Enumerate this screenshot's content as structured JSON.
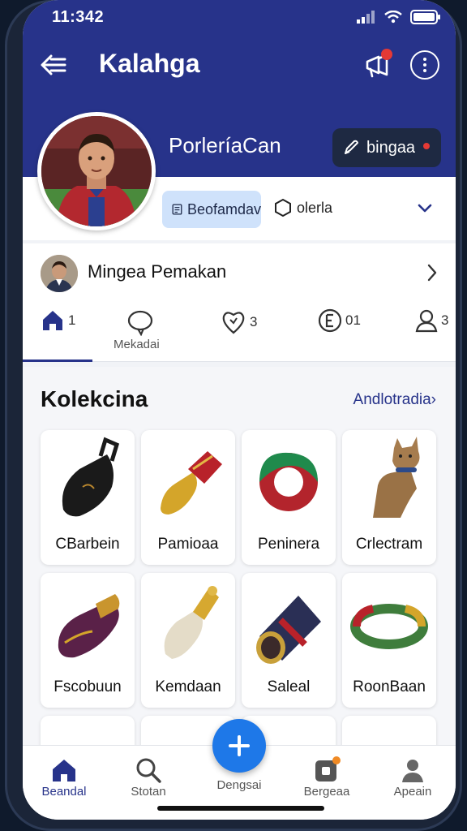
{
  "status_bar": {
    "time": "11:342"
  },
  "app_bar": {
    "title": "Kalahga"
  },
  "profile": {
    "name": "PorleríaCan",
    "action_label": "bingaa",
    "chip_active_label": "Beofamdav",
    "chip_label": "olerla"
  },
  "user_row": {
    "name": "Mingea Pemakan"
  },
  "stats": [
    {
      "value": "1"
    },
    {
      "label": "Mekadai"
    },
    {
      "value": "3"
    },
    {
      "value": "01"
    },
    {
      "value": "3"
    }
  ],
  "collection": {
    "title": "Kolekcina",
    "link": "Andlotradia",
    "items": [
      {
        "label": "CBarbein",
        "icon": "black-bag-icon"
      },
      {
        "label": "Pamioaa",
        "icon": "gold-shoe-icon"
      },
      {
        "label": "Peninera",
        "icon": "green-ring-icon"
      },
      {
        "label": "Crlectram",
        "icon": "cat-figure-icon"
      },
      {
        "label": "Fscobuun",
        "icon": "purple-shoe-icon"
      },
      {
        "label": "Kemdaan",
        "icon": "pearl-ornament-icon"
      },
      {
        "label": "Saleal",
        "icon": "scroll-icon"
      },
      {
        "label": "RoonBaan",
        "icon": "bracelet-icon"
      }
    ]
  },
  "bottom_nav": [
    {
      "label": "Beandal",
      "icon": "home-icon",
      "active": true
    },
    {
      "label": "Stotan",
      "icon": "search-icon"
    },
    {
      "label": "Dengsai",
      "icon": "plus-icon"
    },
    {
      "label": "Bergeaa",
      "icon": "badge-icon"
    },
    {
      "label": "Apeain",
      "icon": "person-icon"
    }
  ],
  "colors": {
    "primary": "#27338a",
    "accent": "#1e78e8",
    "alert": "#e53935"
  }
}
